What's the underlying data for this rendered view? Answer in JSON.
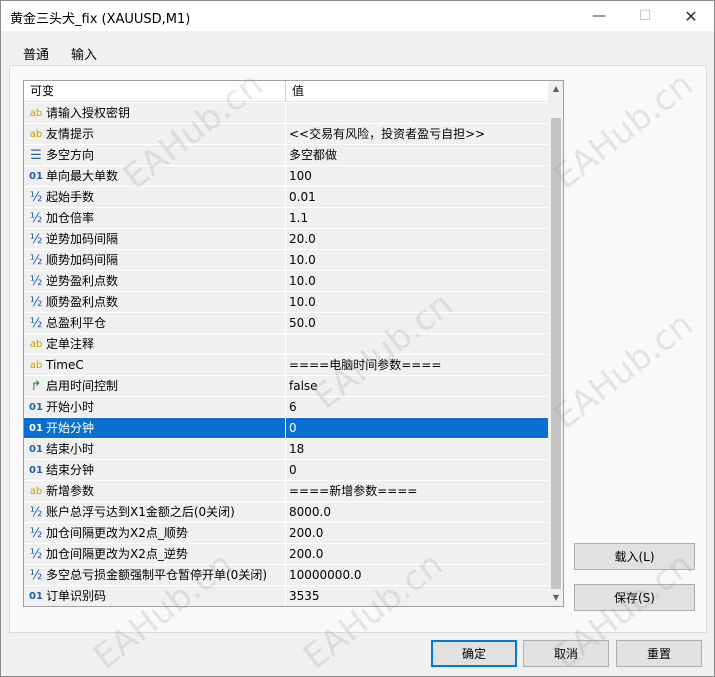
{
  "window": {
    "title": "黄金三头犬_fix (XAUUSD,M1)",
    "minimize_glyph": "—",
    "maximize_glyph": "☐",
    "close_glyph": "✕"
  },
  "tabs": [
    {
      "label": "普通",
      "active": false
    },
    {
      "label": "输入",
      "active": true
    }
  ],
  "grid": {
    "header_name": "可变",
    "header_value": "值",
    "rows": [
      {
        "icon": "ab",
        "name": "请输入授权密钥",
        "value": ""
      },
      {
        "icon": "ab",
        "name": "友情提示",
        "value": "<<交易有风险，投资者盈亏自担>>"
      },
      {
        "icon": "enum",
        "name": "多空方向",
        "value": "多空都做"
      },
      {
        "icon": "01",
        "name": "单向最大单数",
        "value": "100"
      },
      {
        "icon": "½",
        "name": "起始手数",
        "value": "0.01"
      },
      {
        "icon": "½",
        "name": "加仓倍率",
        "value": "1.1"
      },
      {
        "icon": "½",
        "name": "逆势加码间隔",
        "value": "20.0"
      },
      {
        "icon": "½",
        "name": "顺势加码间隔",
        "value": "10.0"
      },
      {
        "icon": "½",
        "name": "逆势盈利点数",
        "value": "10.0"
      },
      {
        "icon": "½",
        "name": "顺势盈利点数",
        "value": "10.0"
      },
      {
        "icon": "½",
        "name": "总盈利平仓",
        "value": "50.0"
      },
      {
        "icon": "ab",
        "name": "定单注释",
        "value": ""
      },
      {
        "icon": "ab",
        "name": "TimeC",
        "value": "====电脑时间参数===="
      },
      {
        "icon": "bool",
        "name": "启用时间控制",
        "value": "false"
      },
      {
        "icon": "01",
        "name": "开始小时",
        "value": "6"
      },
      {
        "icon": "01",
        "name": "开始分钟",
        "value": "0",
        "selected": true
      },
      {
        "icon": "01",
        "name": "结束小时",
        "value": "18"
      },
      {
        "icon": "01",
        "name": "结束分钟",
        "value": "0"
      },
      {
        "icon": "ab",
        "name": "新增参数",
        "value": "====新增参数===="
      },
      {
        "icon": "½",
        "name": "账户总浮亏达到X1金额之后(0关闭)",
        "value": "8000.0"
      },
      {
        "icon": "½",
        "name": "加仓间隔更改为X2点_顺势",
        "value": "200.0"
      },
      {
        "icon": "½",
        "name": "加仓间隔更改为X2点_逆势",
        "value": "200.0"
      },
      {
        "icon": "½",
        "name": "多空总亏损金额强制平仓暂停开单(0关闭)",
        "value": "10000000.0"
      },
      {
        "icon": "01",
        "name": "订单识别码",
        "value": "3535"
      }
    ]
  },
  "buttons": {
    "load": "载入(L)",
    "save": "保存(S)",
    "ok": "确定",
    "cancel": "取消",
    "reset": "重置"
  },
  "watermark_text": "EAHub.cn"
}
